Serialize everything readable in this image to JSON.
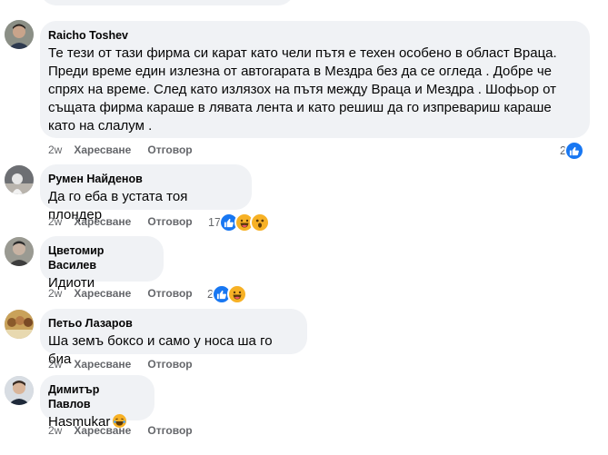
{
  "comments": [
    {
      "author": "Raicho Toshev",
      "text": "Те тези от тази фирма си карат като чели пътя е техен особено в област Враца. Преди време един излезна от автогарата в Мездра без да се огледа . Добре че спрях на време. След като излязох на пътя между Враца и Мездра . Шофьор от същата фирма караше в лявата лента и като решиш да го изпревариш караше като на слалум .",
      "time": "2w",
      "like_label": "Харесване",
      "reply_label": "Отговор",
      "reaction_count": "2",
      "reactions": [
        "like-icon"
      ]
    },
    {
      "author": "Румен Найденов",
      "text": "Да го еба в устата тоя плондер",
      "time": "2w",
      "like_label": "Харесване",
      "reply_label": "Отговор",
      "reaction_count": "17",
      "reactions": [
        "like-icon",
        "haha-icon",
        "wow-icon"
      ]
    },
    {
      "author": "Цветомир Василев",
      "text": "Идиоти",
      "time": "2w",
      "like_label": "Харесване",
      "reply_label": "Отговор",
      "reaction_count": "2",
      "reactions": [
        "like-icon",
        "haha-icon"
      ]
    },
    {
      "author": "Петьо Лазаров",
      "text": "Ша земъ боксо и само у носа ша го биа",
      "time": "2w",
      "like_label": "Харесване",
      "reply_label": "Отговор",
      "reaction_count": "",
      "reactions": []
    },
    {
      "author": "Димитър Павлов",
      "text": "Hasmukar",
      "inline_emoji": "laughing-tears-emoji",
      "time": "2w",
      "like_label": "Харесване",
      "reply_label": "Отговор",
      "reaction_count": "",
      "reactions": []
    }
  ],
  "colors": {
    "bubble": "#f0f2f5",
    "meta_text": "#65676b",
    "like_blue": "#1877f2",
    "emoji_yellow": "#f7b125"
  }
}
